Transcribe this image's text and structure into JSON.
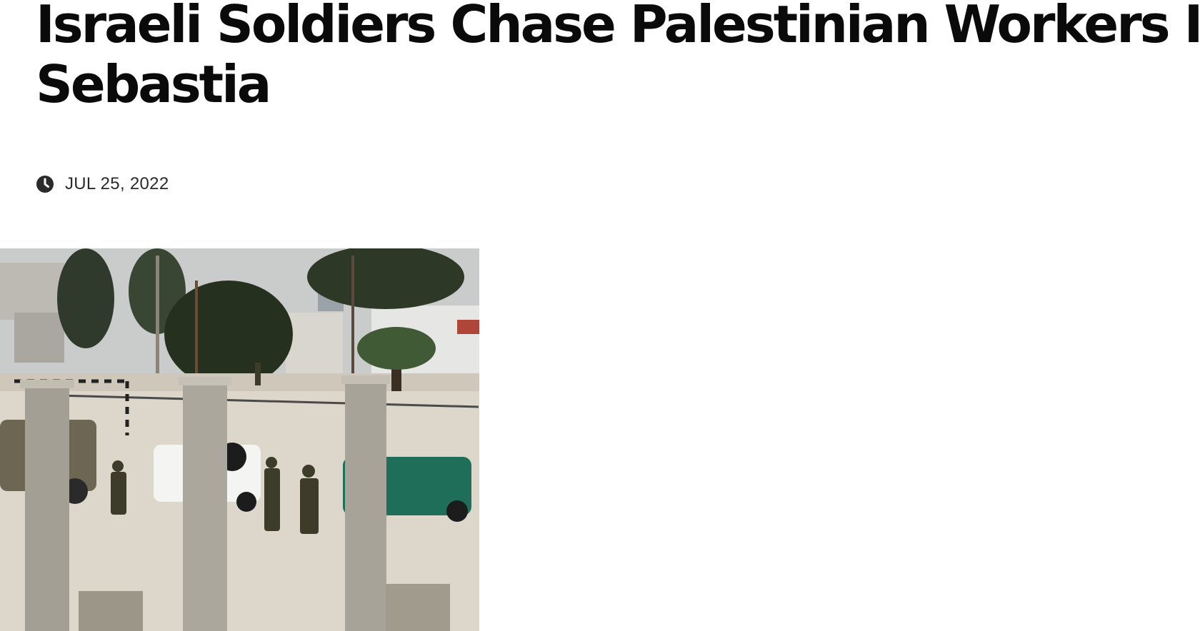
{
  "article": {
    "title_line1": "Israeli Soldiers Chase Palestinian Workers In",
    "title_line2": "Sebastia",
    "date": "JUL 25, 2022"
  },
  "icons": {
    "date": "clock-icon"
  },
  "image": {
    "alt": "Israeli soldiers and vehicles among ancient columns in Sebastia"
  }
}
